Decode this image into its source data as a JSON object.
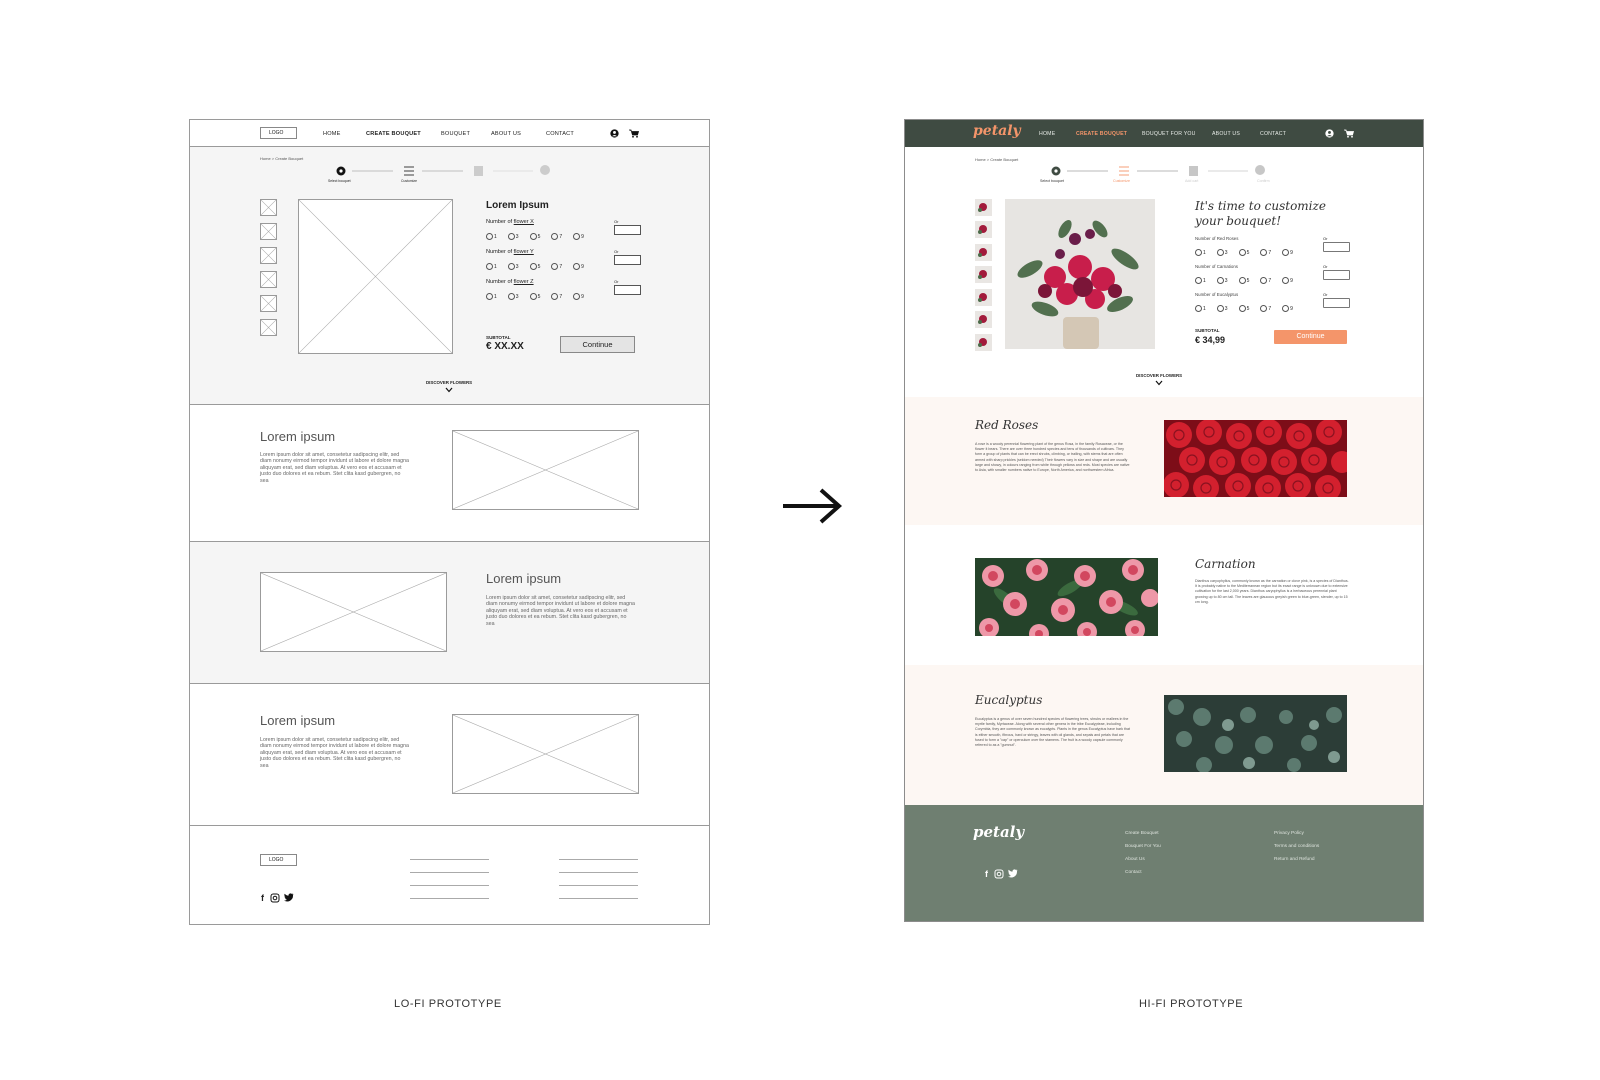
{
  "captions": {
    "lofi": "LO-FI PROTOTYPE",
    "hifi": "HI-FI PROTOTYPE"
  },
  "lofi": {
    "logo": "LOGO",
    "nav": [
      "HOME",
      "CREATE BOUQUET",
      "BOUQUET",
      "ABOUT US",
      "CONTACT"
    ],
    "breadcrumb": "Home > Create Bouquet",
    "steps": [
      "Select bouquet",
      "Customize",
      "",
      ""
    ],
    "product_title": "Lorem Ipsum",
    "questions": [
      {
        "prefix": "Number of ",
        "flower": "flower X"
      },
      {
        "prefix": "Number of ",
        "flower": "flower Y"
      },
      {
        "prefix": "Number of ",
        "flower": "flower Z"
      }
    ],
    "options": [
      "1",
      "3",
      "5",
      "7",
      "9"
    ],
    "or_label": "Or",
    "subtotal_label": "SUBTOTAL",
    "subtotal_value": "€ XX.XX",
    "continue": "Continue",
    "discover": "DISCOVER FLOWERS",
    "sections": [
      {
        "heading": "Lorem ipsum",
        "body": "Lorem ipsum dolor sit amet, consetetur sadipscing elitr, sed diam nonumy eirmod tempor invidunt ut labore et dolore magna aliquyam erat, sed diam voluptua. At vero eos et accusam et justo duo dolores et ea rebum. Stet clita kasd gubergren, no sea"
      },
      {
        "heading": "Lorem ipsum",
        "body": "Lorem ipsum dolor sit amet, consetetur sadipscing elitr, sed diam nonumy eirmod tempor invidunt ut labore et dolore magna aliquyam erat, sed diam voluptua. At vero eos et accusam et justo duo dolores et ea rebum. Stet clita kasd gubergren, no sea"
      },
      {
        "heading": "Lorem ipsum",
        "body": "Lorem ipsum dolor sit amet, consetetur sadipscing elitr, sed diam nonumy eirmod tempor invidunt ut labore et dolore magna aliquyam erat, sed diam voluptua. At vero eos et accusam et justo duo dolores et ea rebum. Stet clita kasd gubergren, no sea"
      }
    ],
    "footer_logo": "LOGO"
  },
  "hifi": {
    "brand": "petaly",
    "nav": [
      "HOME",
      "CREATE BOUQUET",
      "BOUQUET FOR YOU",
      "ABOUT US",
      "CONTACT"
    ],
    "breadcrumb": "Home > Create Bouquet",
    "steps": [
      "Select bouquet",
      "Customize",
      "Add cart",
      "Confirm"
    ],
    "product_title_1": "It's time to customize",
    "product_title_2": "your bouquet!",
    "questions": [
      "Number of Red Roses",
      "Number of Carnations",
      "Number of Eucalyptus"
    ],
    "options": [
      "1",
      "3",
      "5",
      "7",
      "9"
    ],
    "or_label": "Or",
    "subtotal_label": "SUBTOTAL",
    "subtotal_value": "€ 34,99",
    "continue": "Continue",
    "discover": "DISCOVER FLOWERS",
    "flowers": [
      {
        "name": "Red Roses",
        "body": "A rose is a woody perennial flowering plant of the genus Rosa, in the family Rosaceae, or the flower it bears. There are over three hundred species and tens of thousands of cultivars. They form a group of plants that can be erect shrubs, climbing, or trailing, with stems that are often armed with sharp prickles (seldom needed) Their flowers vary in size and shape and are usually large and showy, in colours ranging from white through yellows and reds. Most species are native to Asia, with smaller numbers native to Europe, North America, and northwestern Africa."
      },
      {
        "name": "Carnation",
        "body": "Dianthus caryophyllus, commonly known as the carnation or clove pink, is a species of Dianthus. It is probably native to the Mediterranean region but its exact range is unknown due to extensive cultivation for the last 2,000 years. Dianthus caryophyllus is a herbaceous perennial plant growing up to 80 cm tall. The leaves are glaucous greyish green to blue-green, slender, up to 15 cm long."
      },
      {
        "name": "Eucalyptus",
        "body": "Eucalyptus is a genus of over seven hundred species of flowering trees, shrubs or mallees in the myrtle family, Myrtaceae. Along with several other genera in the tribe Eucalypteae, including Corymbia, they are commonly known as eucalypts. Plants in the genus Eucalyptus have bark that is either smooth, fibrous, hard or stringy, leaves with oil glands, and sepals and petals that are fused to form a \"cap\" or operculum over the stamens. The fruit is a woody capsule commonly referred to as a \"gumnut\"."
      }
    ],
    "footer_col1": [
      "Create Bouquet",
      "Bouquet For You",
      "About Us",
      "Contact"
    ],
    "footer_col2": [
      "Privacy Policy",
      "Terms and conditions",
      "Return and Refund"
    ]
  },
  "colors": {
    "header": "#3f4b42",
    "accent": "#f4956a",
    "footer": "#6f7f71",
    "tint": "#fdf7f3"
  }
}
